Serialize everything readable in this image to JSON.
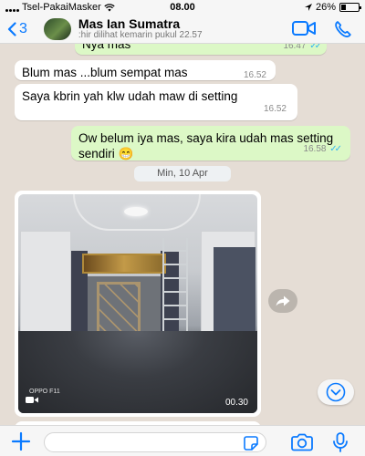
{
  "status_bar": {
    "carrier": "Tsel-PakaiMasker",
    "time": "08.00",
    "battery_text": "26%",
    "battery_level": 0.26,
    "icons": [
      "signal-icon",
      "wifi-icon",
      "location-icon",
      "battery-icon"
    ]
  },
  "header": {
    "back_count": "3",
    "contact_name": "Mas Ian Sumatra",
    "last_seen": ":hir dilihat kemarin pukul 22.57",
    "accent_color": "#0a7aff",
    "icons": [
      "back-chevron-icon",
      "video-call-icon",
      "phone-icon"
    ]
  },
  "messages": [
    {
      "dir": "out",
      "text": "Nya mas",
      "time": "16.47",
      "ticks": "✓✓"
    },
    {
      "dir": "in",
      "text": "Blum mas ...blum sempat mas",
      "time": "16.52"
    },
    {
      "dir": "in",
      "text": "Saya kbrin yah klw udah maw di setting",
      "time": "16.52"
    },
    {
      "dir": "out",
      "text": "Ow belum iya mas, saya kira udah mas setting sendiri 😁",
      "time": "16.58",
      "ticks": "✓✓"
    }
  ],
  "date_separator": "Min, 10 Apr",
  "media_message": {
    "type": "video",
    "watermark": "OPPO F11",
    "duration": "00.30",
    "icons": [
      "video-camera-icon",
      "forward-icon"
    ]
  },
  "input": {
    "placeholder": "",
    "value": "",
    "icons": [
      "plus-icon",
      "sticker-icon",
      "camera-icon",
      "microphone-icon"
    ]
  },
  "colors": {
    "outgoing_bubble": "#dcf8c6",
    "incoming_bubble": "#ffffff",
    "chat_background": "#e5ddd5",
    "read_ticks": "#34b7f1"
  }
}
